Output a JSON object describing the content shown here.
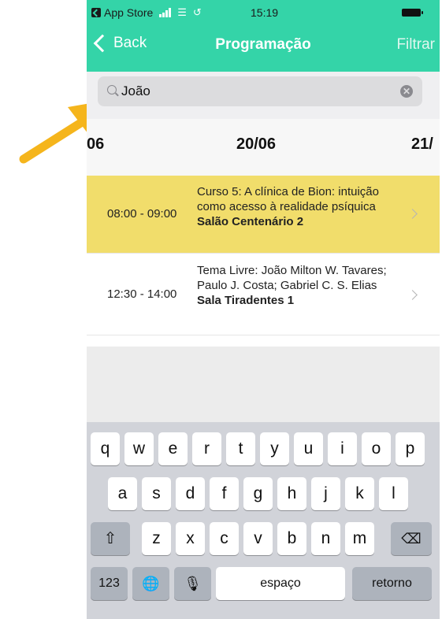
{
  "status": {
    "carrier": "App Store",
    "time": "15:19"
  },
  "nav": {
    "back_label": "Back",
    "title": "Programação",
    "filter_label": "Filtrar"
  },
  "search": {
    "value": "João"
  },
  "dates": [
    "06",
    "20/06",
    "21/"
  ],
  "sessions": [
    {
      "time": "08:00 - 09:00",
      "title": "Curso 5: A clínica de Bion: intuição como acesso à realidade psíquica",
      "place": "Salão Centenário 2"
    },
    {
      "time": "12:30 - 14:00",
      "title": "Tema Livre: João Milton W. Tavares; Paulo J. Costa; Gabriel C. S. Elias",
      "place": "Sala Tiradentes 1"
    }
  ],
  "keyboard": {
    "row1": [
      "q",
      "w",
      "e",
      "r",
      "t",
      "y",
      "u",
      "i",
      "o",
      "p"
    ],
    "row2": [
      "a",
      "s",
      "d",
      "f",
      "g",
      "h",
      "j",
      "k",
      "l"
    ],
    "row3": [
      "z",
      "x",
      "c",
      "v",
      "b",
      "n",
      "m"
    ],
    "numbers_label": "123",
    "space_label": "espaço",
    "return_label": "retorno"
  },
  "colors": {
    "header": "#34d4a8",
    "highlight": "#f1dd6b",
    "arrow": "#f5b51c"
  }
}
